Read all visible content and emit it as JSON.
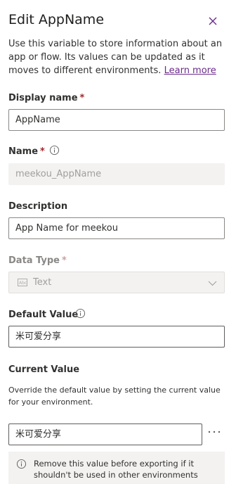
{
  "panel": {
    "title": "Edit AppName",
    "description": "Use this variable to store information about an app or flow. Its values can be updated as it moves to different environments.",
    "learn_more": "Learn more"
  },
  "display_name": {
    "label": "Display name",
    "required_mark": "*",
    "value": "AppName"
  },
  "name": {
    "label": "Name",
    "required_mark": "*",
    "value": "meekou_AppName"
  },
  "description_field": {
    "label": "Description",
    "value": "App Name for meekou"
  },
  "data_type": {
    "label": "Data Type",
    "required_mark": "*",
    "value": "Text"
  },
  "default_value": {
    "label": "Default Value",
    "value": "米可爱分享"
  },
  "current_value": {
    "label": "Current Value",
    "helper": "Override the default value by setting the current value for your environment.",
    "value": "米可爱分享",
    "more_glyph": "···"
  },
  "notice": {
    "text": "Remove this value before exporting if it shouldn't be used in other environments"
  },
  "colors": {
    "accent": "#6b2a8a",
    "required": "#a4262c",
    "disabled_bg": "#f3f2f1"
  }
}
